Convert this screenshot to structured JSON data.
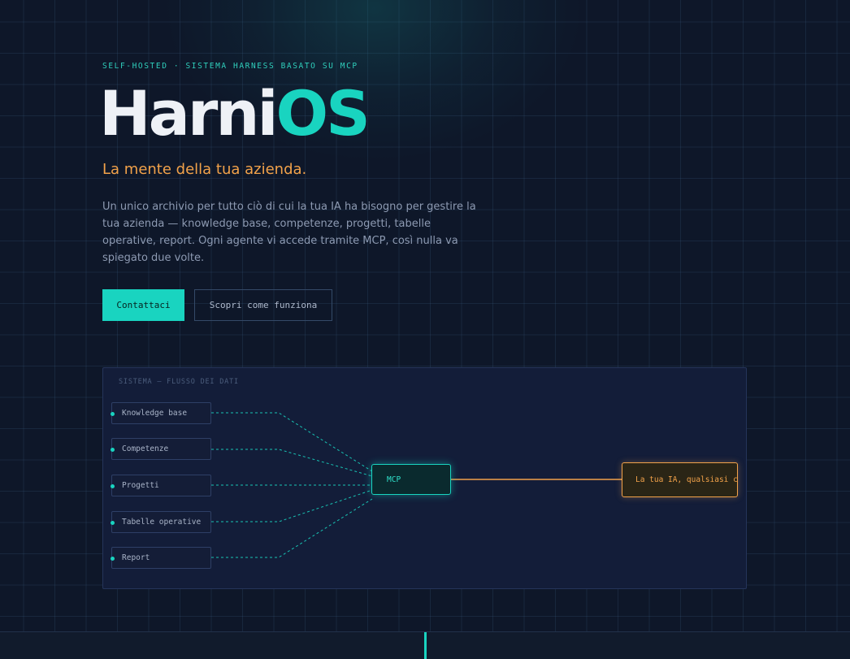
{
  "hero": {
    "eyebrow": "SELF-HOSTED · SISTEMA HARNESS BASATO SU MCP",
    "title_part1": "Harni",
    "title_part2": "OS",
    "tagline": "La mente della tua azienda.",
    "description": "Un unico archivio per tutto ciò di cui la tua IA ha bisogno per gestire la tua azienda — knowledge base, competenze, progetti, tabelle operative, report. Ogni agente vi accede tramite MCP, così nulla va spiegato due volte."
  },
  "buttons": {
    "primary_label": "Contattaci",
    "secondary_label": "Scopri come funziona"
  },
  "diagram": {
    "label": "SISTEMA — FLUSSO DEI DATI",
    "sources": [
      "Knowledge base",
      "Competenze",
      "Progetti",
      "Tabelle operative",
      "Report"
    ],
    "hub": "MCP",
    "target": "La tua IA, qualsiasi cl"
  },
  "colors": {
    "accent_teal": "#19d4c0",
    "accent_orange": "#f2a24a",
    "background": "#0e1729"
  }
}
